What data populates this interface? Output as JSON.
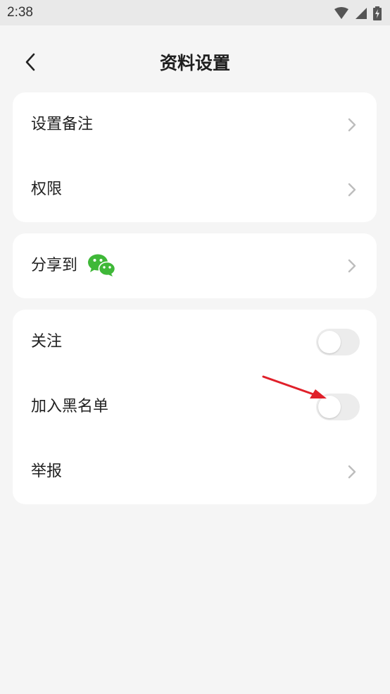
{
  "status_bar": {
    "time": "2:38",
    "icons": [
      "wifi-icon",
      "signal-icon",
      "battery-charging-icon"
    ]
  },
  "header": {
    "title": "资料设置",
    "back_icon": "chevron-left-icon"
  },
  "groups": [
    {
      "items": [
        {
          "label": "设置备注",
          "action": "chevron"
        },
        {
          "label": "权限",
          "action": "chevron"
        }
      ]
    },
    {
      "items": [
        {
          "label": "分享到",
          "action": "chevron",
          "icon": "wechat-icon"
        }
      ]
    },
    {
      "items": [
        {
          "label": "关注",
          "action": "toggle",
          "value": false
        },
        {
          "label": "加入黑名单",
          "action": "toggle",
          "value": false
        },
        {
          "label": "举报",
          "action": "chevron"
        }
      ]
    }
  ],
  "colors": {
    "background": "#f5f5f5",
    "card": "#ffffff",
    "wechat_green": "#3fb838",
    "toggle_off": "#ececec",
    "annotation_arrow": "#e0202a"
  }
}
